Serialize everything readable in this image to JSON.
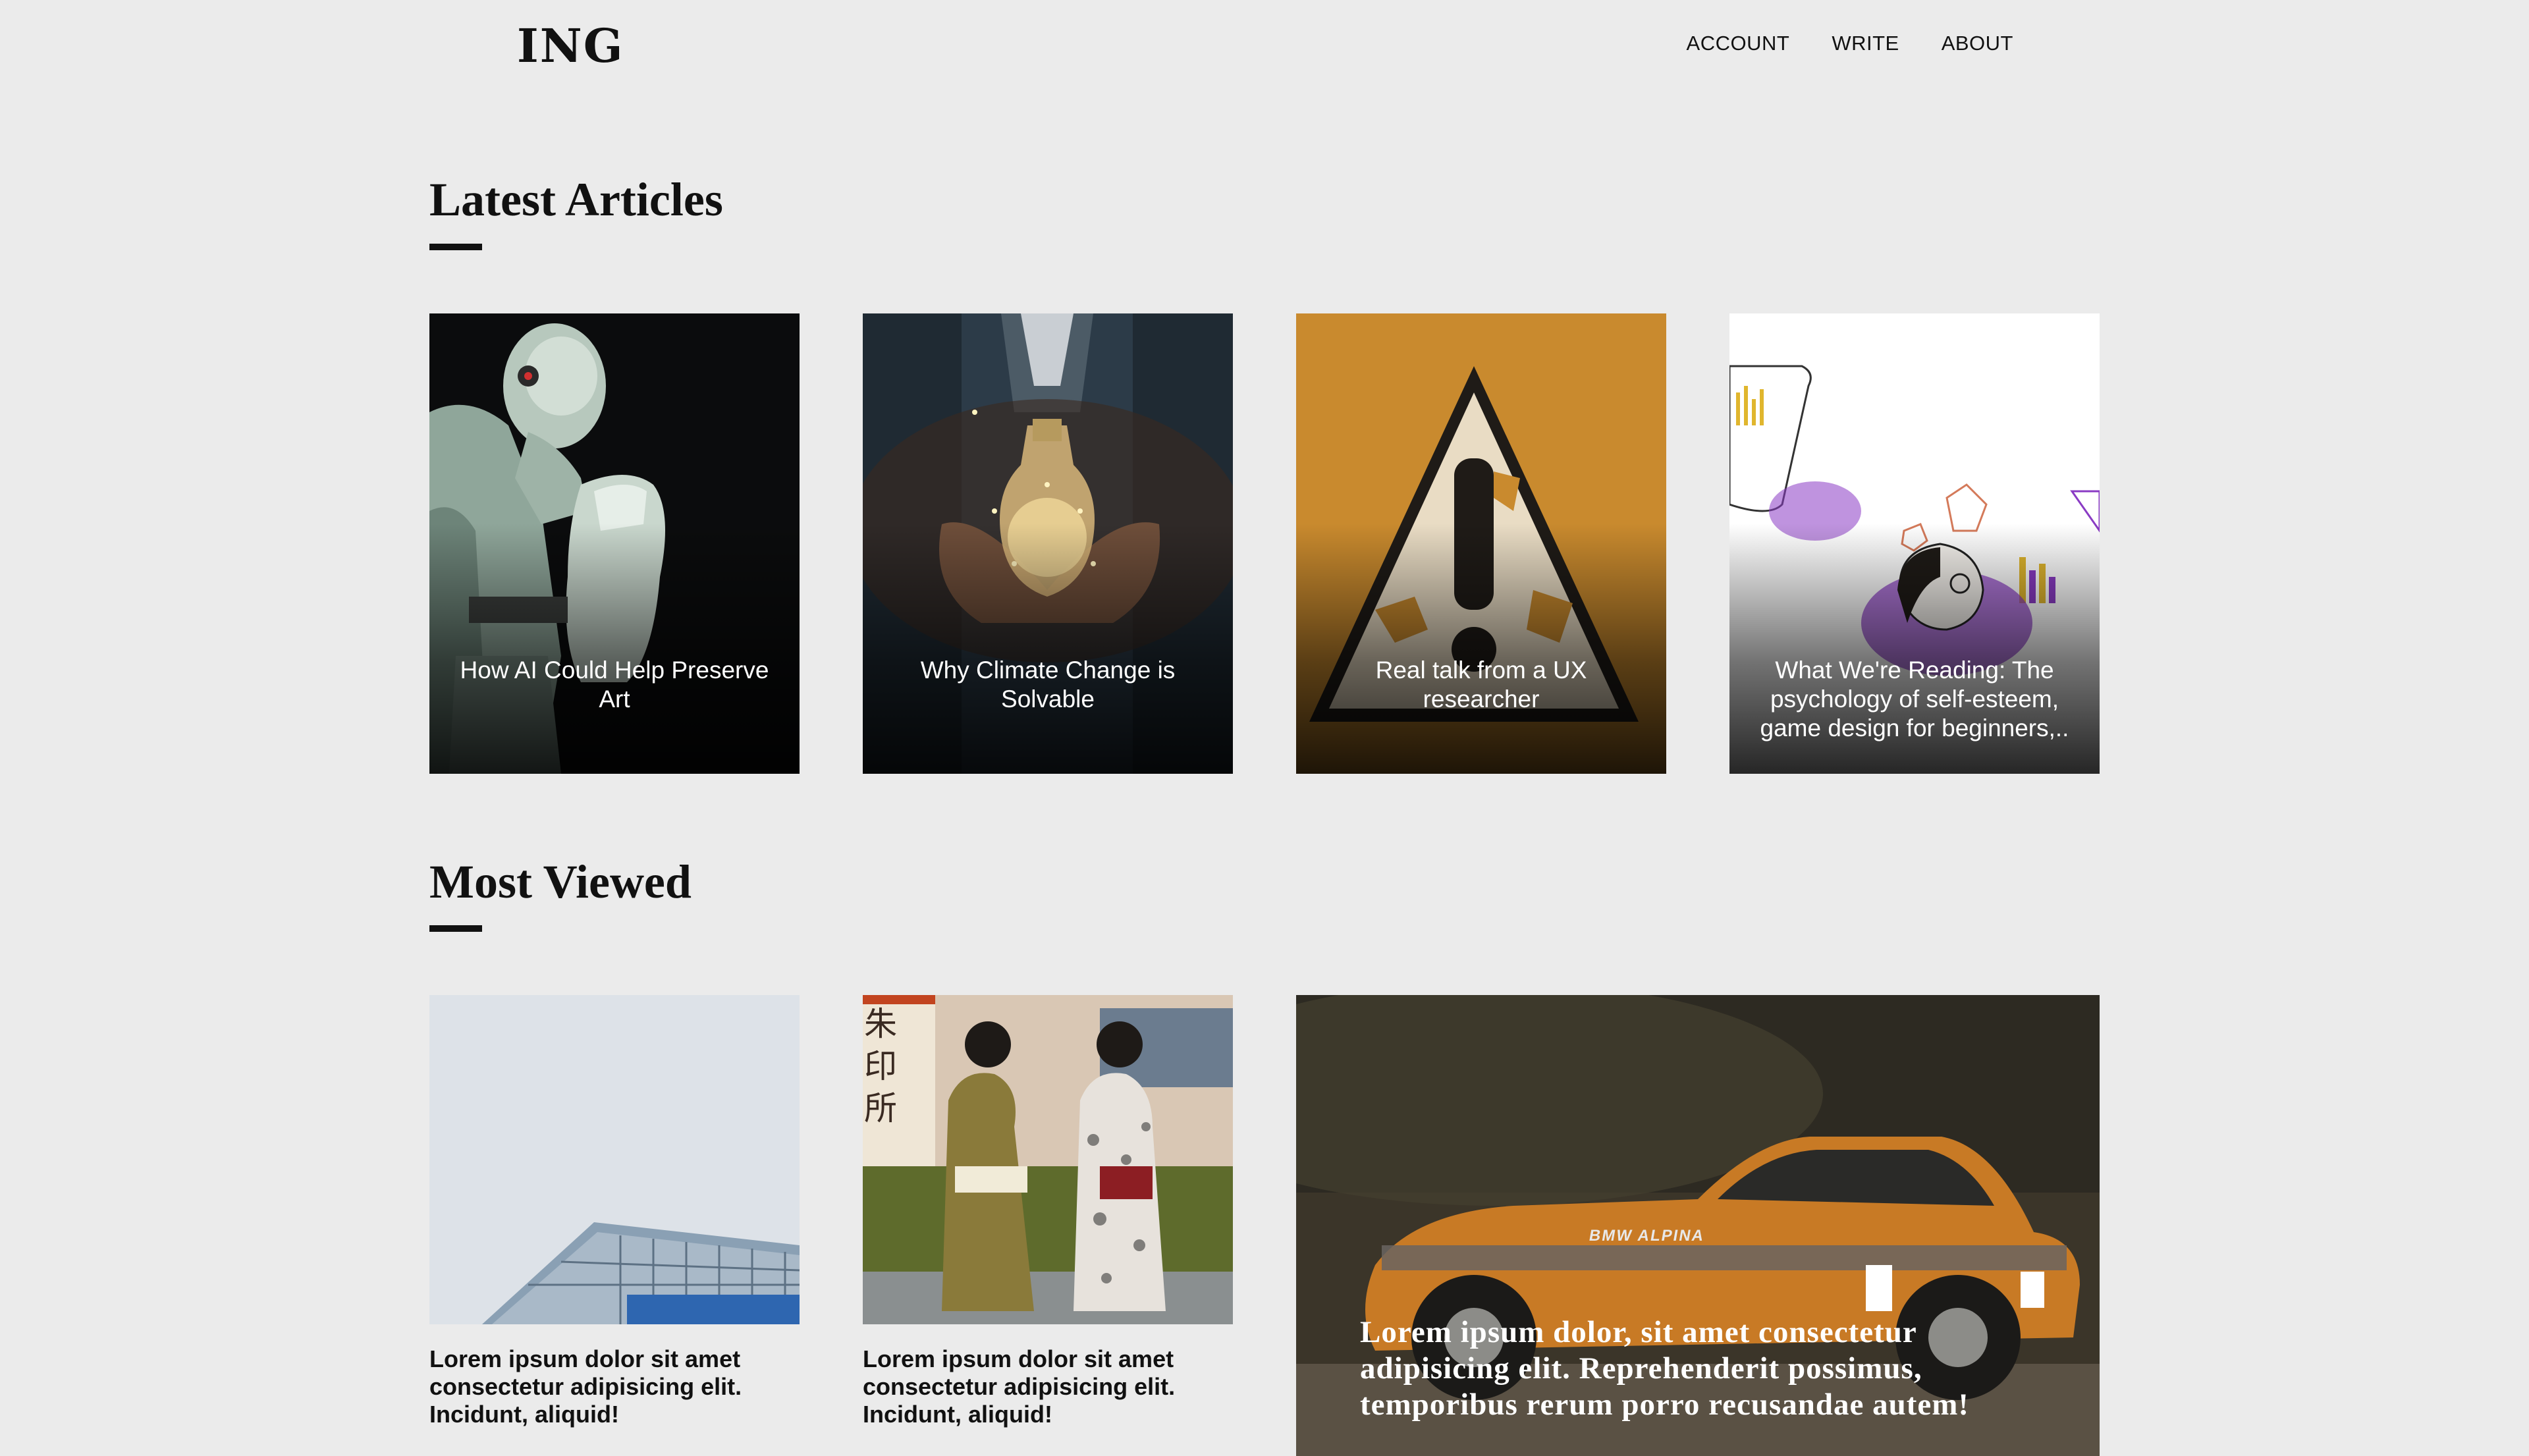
{
  "brand": {
    "logo": "ING"
  },
  "nav": {
    "items": [
      "ACCOUNT",
      "WRITE",
      "ABOUT"
    ]
  },
  "latest": {
    "title": "Latest Articles",
    "cards": [
      {
        "caption": "How AI Could Help Preserve Art"
      },
      {
        "caption": "Why Climate Change is Solvable"
      },
      {
        "caption": "Real talk from a UX researcher"
      },
      {
        "caption": "What We're Reading: The psychology of self-esteem, game design for beginners,.."
      }
    ]
  },
  "most_viewed": {
    "title": "Most Viewed",
    "cards": [
      {
        "text": "Lorem ipsum dolor sit amet consectetur adipisicing elit. Incidunt, aliquid!"
      },
      {
        "text": "Lorem ipsum dolor sit amet consectetur adipisicing elit. Incidunt, aliquid!"
      }
    ],
    "feature": {
      "text": "Lorem ipsum dolor, sit amet consectetur adipisicing elit. Reprehenderit possimus, temporibus rerum porro recusandae autem!",
      "plate": "BMW ALPINA",
      "kanji": "朱印所"
    }
  },
  "colors": {
    "background": "#ebebeb",
    "text": "#111111",
    "caption": "#ffffff"
  }
}
